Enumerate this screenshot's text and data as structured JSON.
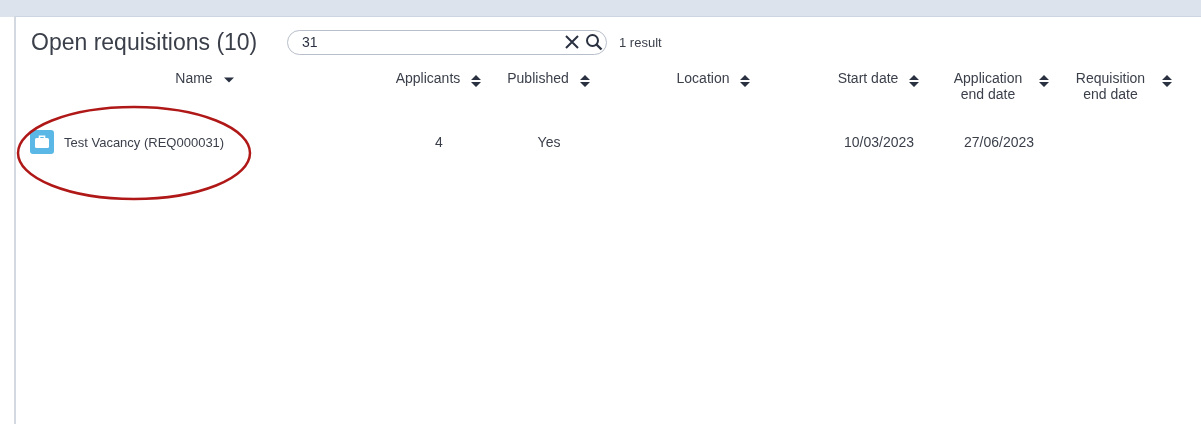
{
  "header": {
    "title": "Open requisitions (10)",
    "search": {
      "value": "31"
    },
    "result_count": "1 result"
  },
  "table": {
    "columns": [
      {
        "label": "Name",
        "sorted": true
      },
      {
        "label": "Applicants",
        "sorted": false
      },
      {
        "label": "Published",
        "sorted": false
      },
      {
        "label": "Location",
        "sorted": false
      },
      {
        "label": "Start date",
        "sorted": false
      },
      {
        "label": "Application end date",
        "sorted": false
      },
      {
        "label": "Requisition end date",
        "sorted": false
      }
    ],
    "rows": [
      {
        "cells": [
          "Test Vacancy (REQ000031)",
          "4",
          "Yes",
          "",
          "10/03/2023",
          "27/06/2023",
          ""
        ]
      }
    ]
  },
  "annotation": {
    "kind": "ellipse",
    "color": "#b01818"
  }
}
